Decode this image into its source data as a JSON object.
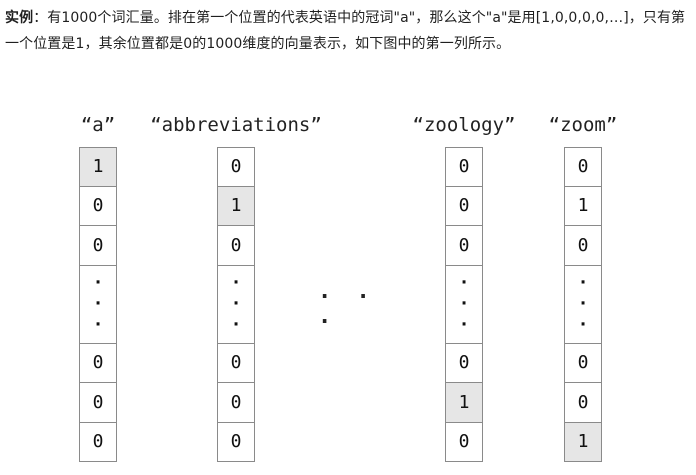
{
  "intro": {
    "label": "实例",
    "text": "：有1000个词汇量。排在第一个位置的代表英语中的冠词\"a\"，那么这个\"a\"是用[1,0,0,0,0,…]，只有第一个位置是1，其余位置都是0的1000维度的向量表示，如下图中的第一列所示。"
  },
  "ellipsis": "· · ·",
  "columns": [
    {
      "word": "“a”",
      "top": [
        "1",
        "0",
        "0"
      ],
      "bottom": [
        "0",
        "0",
        "0"
      ],
      "hot": "0"
    },
    {
      "word": "“abbreviations”",
      "top": [
        "0",
        "1",
        "0"
      ],
      "bottom": [
        "0",
        "0",
        "0"
      ],
      "hot": "1"
    },
    {
      "word": "“zoology”",
      "top": [
        "0",
        "0",
        "0"
      ],
      "bottom": [
        "0",
        "1",
        "0"
      ],
      "hot": "4"
    },
    {
      "word": "“zoom”",
      "top": [
        "0",
        "1",
        "0"
      ],
      "bottom": [
        "0",
        "0",
        "1"
      ],
      "hot": "5"
    }
  ],
  "vdots": [
    "·",
    "·",
    "·"
  ]
}
